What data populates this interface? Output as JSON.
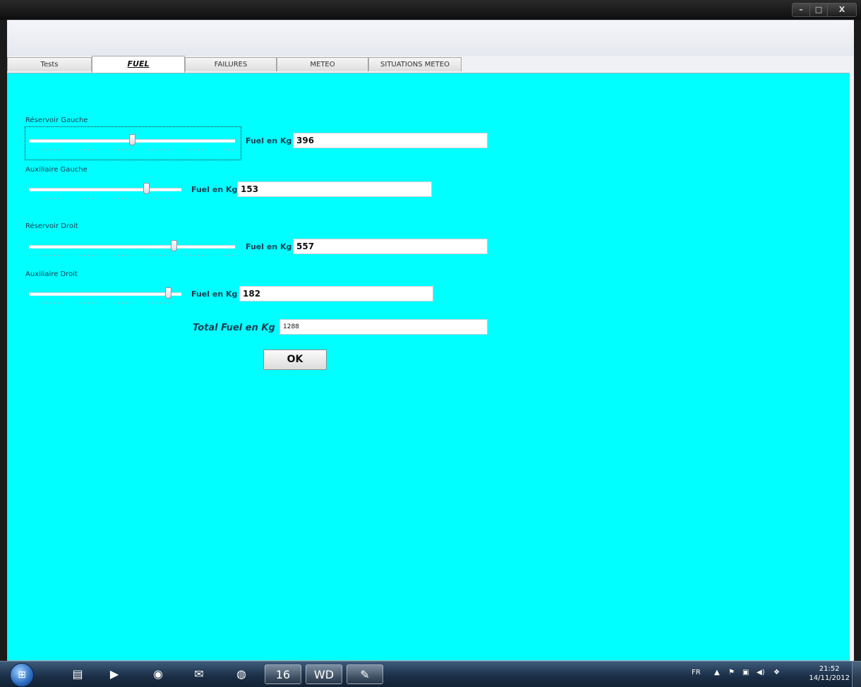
{
  "window": {
    "controls": {
      "minimize": "–",
      "maximize": "□",
      "close": "X"
    }
  },
  "tabs": [
    {
      "label": "Tests"
    },
    {
      "label": "FUEL"
    },
    {
      "label": "FAILURES"
    },
    {
      "label": "METEO"
    },
    {
      "label": "SITUATIONS METEO"
    }
  ],
  "active_tab": "FUEL",
  "tanks": [
    {
      "label": "Réservoir Gauche",
      "fuel_label": "Fuel en Kg",
      "value": "396"
    },
    {
      "label": "Auxiliaire Gauche",
      "fuel_label": "Fuel en Kg",
      "value": "153"
    },
    {
      "label": "Réservoir Droit",
      "fuel_label": "Fuel en Kg",
      "value": "557"
    },
    {
      "label": "Auxiliaire Droit",
      "fuel_label": "Fuel en Kg",
      "value": "182"
    }
  ],
  "total": {
    "label": "Total Fuel en Kg",
    "value": "1288"
  },
  "ok_label": "OK",
  "taskbar": {
    "start_icon": "windows-start-icon",
    "apps": [
      {
        "icon": "file-explorer-icon",
        "glyph": "▤"
      },
      {
        "icon": "media-player-icon",
        "glyph": "▶"
      },
      {
        "icon": "firefox-icon",
        "glyph": "◉"
      },
      {
        "icon": "thunderbird-icon",
        "glyph": "✉"
      },
      {
        "icon": "chrome-icon",
        "glyph": "◍"
      },
      {
        "icon": "windev-16-icon",
        "glyph": "16"
      },
      {
        "icon": "windev-wd-icon",
        "glyph": "WD"
      },
      {
        "icon": "paint-icon",
        "glyph": "✎"
      }
    ],
    "tray": {
      "language": "FR",
      "icons": [
        "show-hidden-icons-icon",
        "action-center-flag-icon",
        "network-icon",
        "volume-icon",
        "dropbox-icon"
      ],
      "tray_glyphs": [
        "▲",
        "⚑",
        "▣",
        "◀)",
        "❖"
      ],
      "time": "21:52",
      "date": "14/11/2012"
    }
  },
  "colors": {
    "panel": "#00ffff",
    "label_text": "#1f3d52",
    "taskbar": "#1a2e45"
  }
}
